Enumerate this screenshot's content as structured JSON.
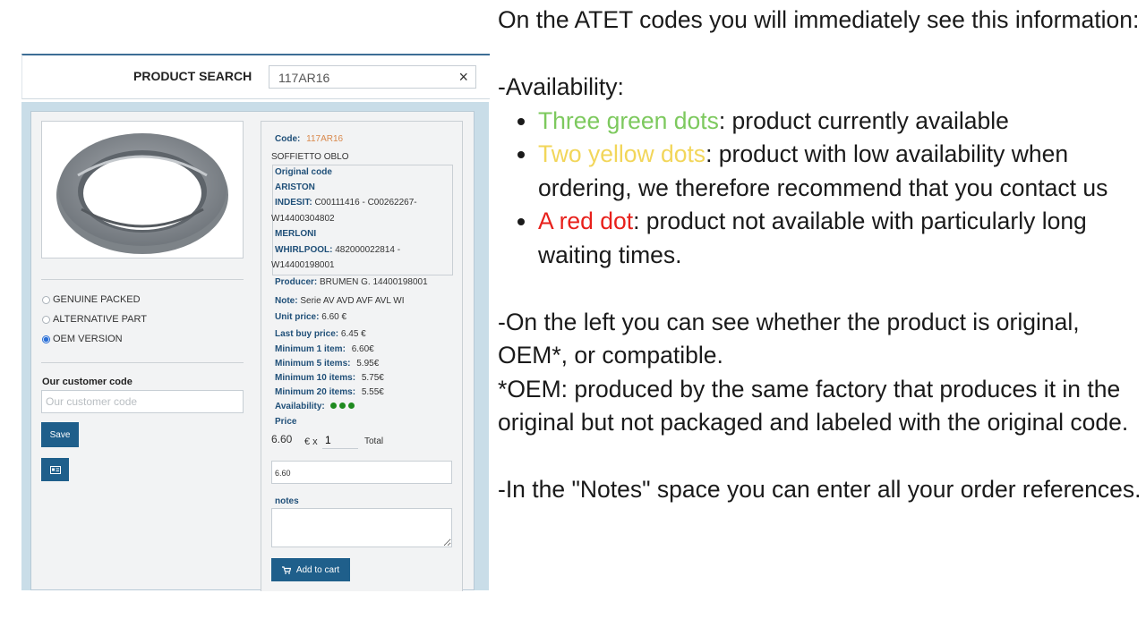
{
  "search": {
    "label": "PRODUCT SEARCH",
    "value": "117AR16",
    "clear_icon": "×"
  },
  "options": [
    {
      "label": "GENUINE PACKED",
      "selected": false
    },
    {
      "label": "ALTERNATIVE PART",
      "selected": false
    },
    {
      "label": "OEM VERSION",
      "selected": true
    }
  ],
  "customer": {
    "label": "Our customer code",
    "placeholder": "Our customer code",
    "save_label": "Save"
  },
  "product": {
    "code_label": "Code:",
    "code_value": "117AR16",
    "description": "SOFFIETTO OBLO",
    "original_code_label": "Original code",
    "brands": [
      {
        "name": "ARISTON"
      },
      {
        "name": "INDESIT:",
        "codes_line1": "C00111416 - C00262267-",
        "codes_line2": "W14400304802"
      },
      {
        "name": "MERLONI"
      },
      {
        "name": "WHIRLPOOL:",
        "codes_line1": "482000022814 -",
        "codes_line2": "W14400198001"
      }
    ],
    "producer_label": "Producer:",
    "producer_value": "BRUMEN G. 14400198001",
    "note_label": "Note:",
    "note_value": "Serie AV AVD AVF AVL WI",
    "unit_price_label": "Unit price:",
    "unit_price_value": "6.60 €",
    "last_buy_label": "Last buy price:",
    "last_buy_value": "6.45 €",
    "tiers": [
      {
        "label": "Minimum 1 item:",
        "value": "6.60€"
      },
      {
        "label": "Minimum 5 items:",
        "value": "5.95€"
      },
      {
        "label": "Minimum 10 items:",
        "value": "5.75€"
      },
      {
        "label": "Minimum 20 items:",
        "value": "5.55€"
      }
    ],
    "availability_label": "Availability:",
    "availability_dots": 3,
    "availability_color": "#1f8a1f",
    "price_label": "Price",
    "price_value": "6.60",
    "currency_times": "€ x",
    "quantity": "1",
    "total_label": "Total",
    "total_value": "6.60",
    "notes_label": "notes",
    "add_to_cart_label": "Add to cart"
  },
  "explanation": {
    "intro": "On the ATET codes you will immediately see this information:",
    "availability_heading": "-Availability:",
    "bullets": [
      {
        "highlight": "Three green dots",
        "rest": ": product currently available",
        "color": "#7dc95e"
      },
      {
        "highlight": "Two yellow dots",
        "rest": ": product with low availability when ordering, we therefore recommend that you contact us",
        "color": "#f2d65a"
      },
      {
        "highlight": "A red dot",
        "rest": ": product not available with particularly long waiting times.",
        "color": "#e8201b"
      }
    ],
    "left_side": "-On the left you can see whether the product is original, OEM*, or compatible.",
    "oem_note": "*OEM: produced by the same factory that produces it in the original but not packaged and labeled with the original code.",
    "notes_tip": "-In the \"Notes\" space you can enter all your order references."
  }
}
